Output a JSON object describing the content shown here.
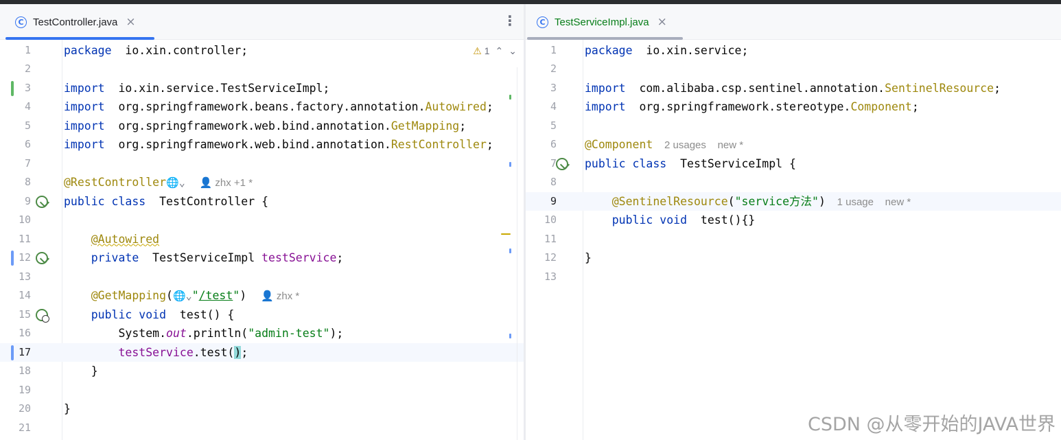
{
  "left_tab": {
    "label": "TestController.java",
    "close": "×",
    "icon": "class-icon",
    "icon_glyph": "C"
  },
  "right_tab": {
    "label": "TestServiceImpl.java",
    "close": "×",
    "icon": "class-icon",
    "icon_glyph": "C"
  },
  "more_glyph": "⋮",
  "inspections": {
    "warning_count": "1",
    "warning_glyph": "⚠",
    "up_glyph": "⌃",
    "down_glyph": "⌄"
  },
  "colors": {
    "accent": "#3574f0",
    "change_added": "#5fb865",
    "change_modified": "#6c9bf7",
    "keyword": "#0033b3",
    "annotation": "#9e880d",
    "string": "#067d17"
  },
  "left_lines": [
    {
      "n": "1",
      "segs": [
        [
          "kw",
          "package"
        ],
        [
          "",
          "  io.xin.controller;"
        ]
      ]
    },
    {
      "n": "2",
      "segs": []
    },
    {
      "n": "3",
      "segs": [
        [
          "kw",
          "import"
        ],
        [
          "",
          "  io.xin.service.TestServiceImpl;"
        ]
      ]
    },
    {
      "n": "4",
      "segs": [
        [
          "kw",
          "import"
        ],
        [
          "",
          "  org.springframework.beans.factory.annotation."
        ],
        [
          "cls",
          "Autowired"
        ],
        [
          "",
          ";"
        ]
      ]
    },
    {
      "n": "5",
      "segs": [
        [
          "kw",
          "import"
        ],
        [
          "",
          "  org.springframework.web.bind.annotation."
        ],
        [
          "cls",
          "GetMapping"
        ],
        [
          "",
          ";"
        ]
      ]
    },
    {
      "n": "6",
      "segs": [
        [
          "kw",
          "import"
        ],
        [
          "",
          "  org.springframework.web.bind.annotation."
        ],
        [
          "cls",
          "RestController"
        ],
        [
          "",
          ";"
        ]
      ]
    },
    {
      "n": "7",
      "segs": []
    },
    {
      "n": "8",
      "segs": [
        [
          "ann",
          "@RestController"
        ],
        [
          "globe",
          "🌐⌄"
        ],
        [
          "hint",
          "     👤 zhx +1 *"
        ]
      ]
    },
    {
      "n": "9",
      "segs": [
        [
          "kw",
          "public class"
        ],
        [
          "",
          "  TestController {"
        ]
      ]
    },
    {
      "n": "10",
      "segs": []
    },
    {
      "n": "11",
      "segs": [
        [
          "",
          "    "
        ],
        [
          "ann typo",
          "@Autowired"
        ]
      ]
    },
    {
      "n": "12",
      "segs": [
        [
          "",
          "    "
        ],
        [
          "kw",
          "private"
        ],
        [
          "",
          "  TestServiceImpl "
        ],
        [
          "fld",
          "testService"
        ],
        [
          "",
          ";"
        ]
      ]
    },
    {
      "n": "13",
      "segs": []
    },
    {
      "n": "14",
      "segs": [
        [
          "",
          "    "
        ],
        [
          "ann",
          "@GetMapping"
        ],
        [
          "",
          "("
        ],
        [
          "globe",
          "🌐⌄"
        ],
        [
          "str",
          "\""
        ],
        [
          "url",
          "/test"
        ],
        [
          "str",
          "\""
        ],
        [
          "",
          ")"
        ],
        [
          "hint",
          "     👤 zhx *"
        ]
      ]
    },
    {
      "n": "15",
      "segs": [
        [
          "",
          "    "
        ],
        [
          "kw",
          "public void"
        ],
        [
          "",
          "  test() {"
        ]
      ]
    },
    {
      "n": "16",
      "segs": [
        [
          "",
          "        System."
        ],
        [
          "stat",
          "out"
        ],
        [
          "",
          ".println("
        ],
        [
          "str",
          "\"admin-test\""
        ],
        [
          "",
          ");"
        ]
      ]
    },
    {
      "n": "17",
      "segs": [
        [
          "",
          "        "
        ],
        [
          "fld",
          "testService"
        ],
        [
          "",
          ".test("
        ],
        [
          "brace-hl",
          ")"
        ],
        [
          "",
          ";"
        ]
      ]
    },
    {
      "n": "18",
      "segs": [
        [
          "",
          "    }"
        ]
      ]
    },
    {
      "n": "19",
      "segs": []
    },
    {
      "n": "20",
      "segs": [
        [
          "",
          "}"
        ]
      ]
    },
    {
      "n": "21",
      "segs": []
    }
  ],
  "right_lines": [
    {
      "n": "1",
      "segs": [
        [
          "kw",
          "package"
        ],
        [
          "",
          "  io.xin.service;"
        ]
      ]
    },
    {
      "n": "2",
      "segs": []
    },
    {
      "n": "3",
      "segs": [
        [
          "kw",
          "import"
        ],
        [
          "",
          "  com.alibaba.csp.sentinel.annotation."
        ],
        [
          "cls",
          "SentinelResource"
        ],
        [
          "",
          ";"
        ]
      ]
    },
    {
      "n": "4",
      "segs": [
        [
          "kw",
          "import"
        ],
        [
          "",
          "  org.springframework.stereotype."
        ],
        [
          "cls",
          "Component"
        ],
        [
          "",
          ";"
        ]
      ]
    },
    {
      "n": "5",
      "segs": []
    },
    {
      "n": "6",
      "segs": [
        [
          "ann",
          "@Component"
        ],
        [
          "hint",
          "    2 usages    new *"
        ]
      ]
    },
    {
      "n": "7",
      "segs": [
        [
          "kw",
          "public class"
        ],
        [
          "",
          "  TestServiceImpl {"
        ]
      ]
    },
    {
      "n": "8",
      "segs": []
    },
    {
      "n": "9",
      "segs": [
        [
          "",
          "    "
        ],
        [
          "ann",
          "@SentinelResource"
        ],
        [
          "",
          "("
        ],
        [
          "str",
          "\"service方法\""
        ],
        [
          "",
          ")"
        ],
        [
          "hint",
          "    1 usage    new *"
        ]
      ]
    },
    {
      "n": "10",
      "segs": [
        [
          "",
          "    "
        ],
        [
          "kw",
          "public void"
        ],
        [
          "",
          "  test(){}"
        ]
      ]
    },
    {
      "n": "11",
      "segs": []
    },
    {
      "n": "12",
      "segs": [
        [
          "",
          "}"
        ]
      ]
    },
    {
      "n": "13",
      "segs": []
    }
  ],
  "watermark": "CSDN @从零开始的JAVA世界"
}
